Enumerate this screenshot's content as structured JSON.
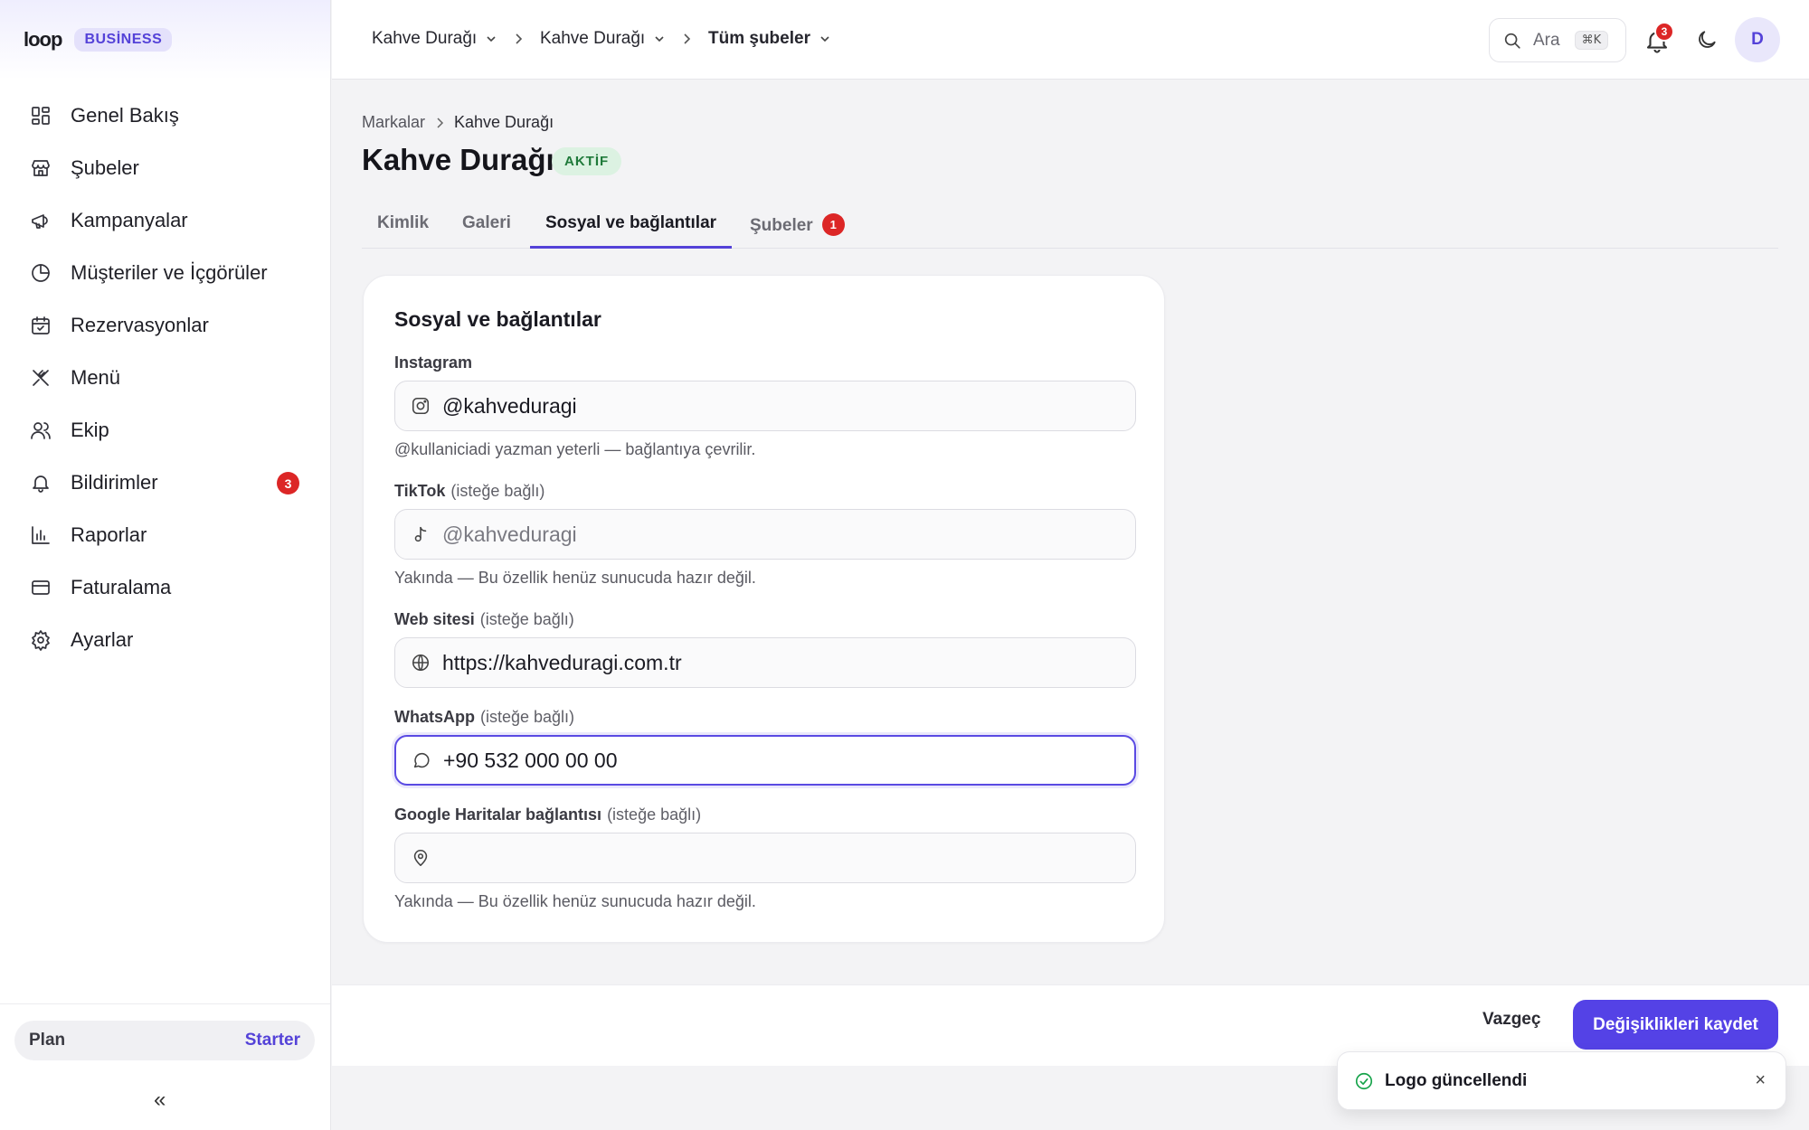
{
  "app": {
    "logo_text": "loop",
    "edition_badge": "BUSİNESS"
  },
  "sidebar": {
    "items": [
      {
        "label": "Genel Bakış",
        "icon": "dashboard-icon"
      },
      {
        "label": "Şubeler",
        "icon": "store-icon"
      },
      {
        "label": "Kampanyalar",
        "icon": "megaphone-icon"
      },
      {
        "label": "Müşteriler ve İçgörüler",
        "icon": "pie-chart-icon"
      },
      {
        "label": "Rezervasyonlar",
        "icon": "calendar-check-icon"
      },
      {
        "label": "Menü",
        "icon": "utensils-icon"
      },
      {
        "label": "Ekip",
        "icon": "users-icon"
      },
      {
        "label": "Bildirimler",
        "icon": "bell-icon",
        "badge": "3"
      },
      {
        "label": "Raporlar",
        "icon": "bar-chart-icon"
      },
      {
        "label": "Faturalama",
        "icon": "credit-card-icon"
      },
      {
        "label": "Ayarlar",
        "icon": "gear-icon"
      }
    ],
    "plan": {
      "label": "Plan",
      "value": "Starter"
    },
    "collapse_icon": "«"
  },
  "topbar": {
    "crumbs": [
      "Kahve Durağı",
      "Kahve Durağı",
      "Tüm şubeler"
    ],
    "search": {
      "label": "Ara",
      "shortcut": "⌘K"
    },
    "notifications_count": "3",
    "avatar_initial": "D"
  },
  "page": {
    "breadcrumb": [
      "Markalar",
      "Kahve Durağı"
    ],
    "title": "Kahve Durağı",
    "status": "AKTİF",
    "tabs": [
      {
        "label": "Kimlik"
      },
      {
        "label": "Galeri"
      },
      {
        "label": "Sosyal ve bağlantılar",
        "active": true
      },
      {
        "label": "Şubeler",
        "badge": "1"
      }
    ]
  },
  "form": {
    "title": "Sosyal ve bağlantılar",
    "optional_text": "(isteğe bağlı)",
    "fields": {
      "instagram": {
        "label": "Instagram",
        "value": "@kahveduragi",
        "placeholder": "",
        "hint": "@kullaniciadi yazman yeterli — bağlantıya çevrilir."
      },
      "tiktok": {
        "label": "TikTok",
        "value": "",
        "placeholder": "@kahveduragi",
        "hint": "Yakında — Bu özellik henüz sunucuda hazır değil."
      },
      "website": {
        "label": "Web sitesi",
        "value": "https://kahveduragi.com.tr",
        "placeholder": ""
      },
      "whatsapp": {
        "label": "WhatsApp",
        "value": "+90 532 000 00 00",
        "placeholder": ""
      },
      "maps": {
        "label": "Google Haritalar bağlantısı",
        "value": "",
        "placeholder": "",
        "hint": "Yakında — Bu özellik henüz sunucuda hazır değil."
      }
    }
  },
  "footer": {
    "cancel_label": "Vazgeç",
    "save_label": "Değişiklikleri kaydet"
  },
  "toast": {
    "message": "Logo güncellendi",
    "close_icon": "×"
  },
  "colors": {
    "accent": "#5442E6",
    "badge_red": "#DC2626",
    "success_bg": "#DCF2E2",
    "success_text": "#1F7A3A"
  }
}
